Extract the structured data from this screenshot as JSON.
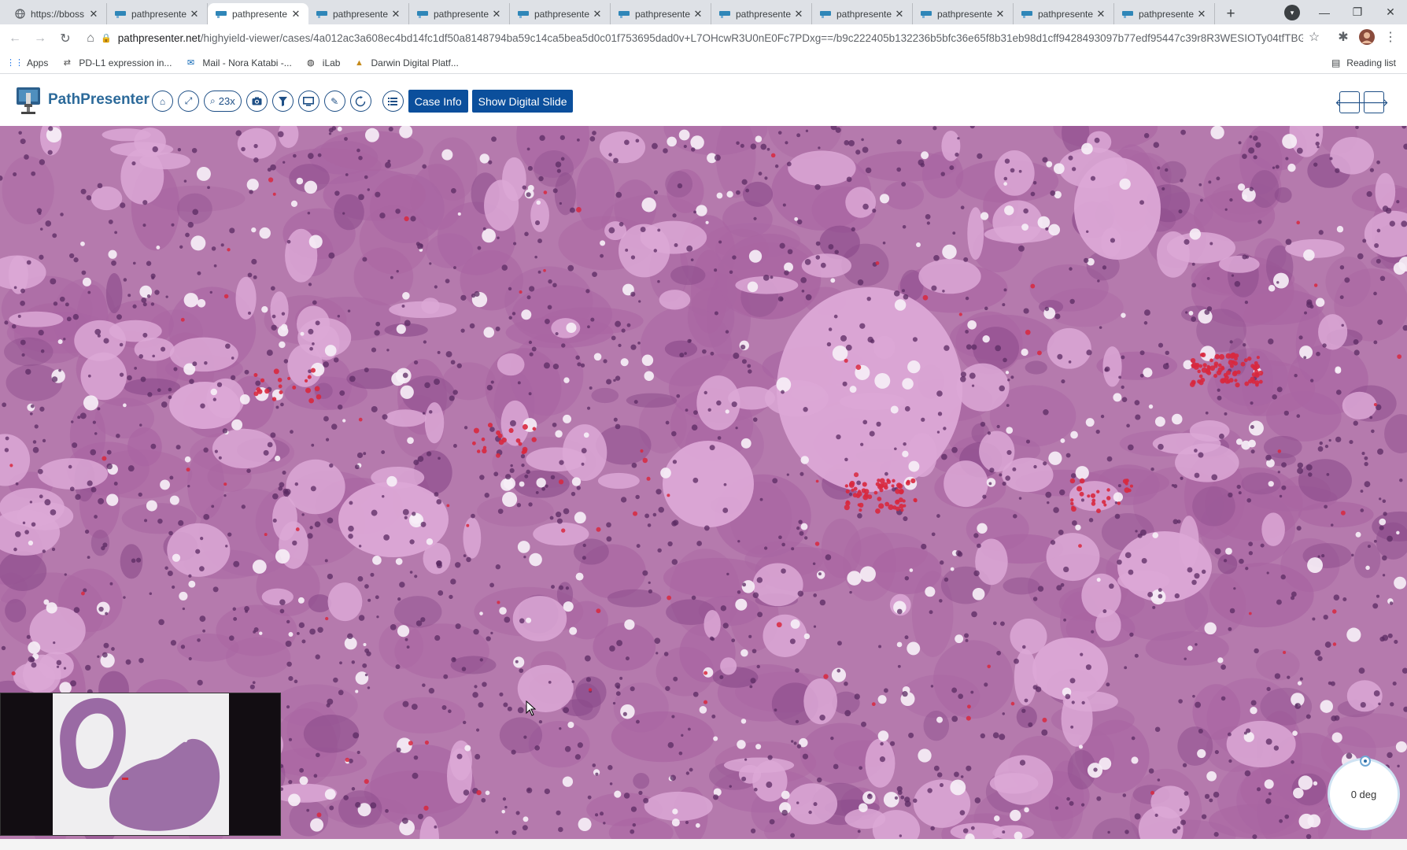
{
  "browser": {
    "tabs": [
      {
        "title": "https://bboss",
        "icon": "globe-icon",
        "active": false
      },
      {
        "title": "pathpresente",
        "icon": "pathpresenter-favicon",
        "active": false
      },
      {
        "title": "pathpresente",
        "icon": "pathpresenter-favicon",
        "active": true
      },
      {
        "title": "pathpresente",
        "icon": "pathpresenter-favicon",
        "active": false
      },
      {
        "title": "pathpresente",
        "icon": "pathpresenter-favicon",
        "active": false
      },
      {
        "title": "pathpresente",
        "icon": "pathpresenter-favicon",
        "active": false
      },
      {
        "title": "pathpresente",
        "icon": "pathpresenter-favicon",
        "active": false
      },
      {
        "title": "pathpresente",
        "icon": "pathpresenter-favicon",
        "active": false
      },
      {
        "title": "pathpresente",
        "icon": "pathpresenter-favicon",
        "active": false
      },
      {
        "title": "pathpresente",
        "icon": "pathpresenter-favicon",
        "active": false
      },
      {
        "title": "pathpresente",
        "icon": "pathpresenter-favicon",
        "active": false
      },
      {
        "title": "pathpresente",
        "icon": "pathpresenter-favicon",
        "active": false
      }
    ],
    "tab_close_glyph": "✕",
    "new_tab_glyph": "+",
    "url_host": "pathpresenter.net",
    "url_path": "/highyield-viewer/cases/4a012ac3a608ec4bd14fc1df50a8148794ba59c14ca5bea5d0c01f753695dad0v+L7OHcwR3U0nE0Fc7PDxg==/b9c222405b132236b5bfc36e65f8b31eb98d1cff9428493097b77edf95447c39r8R3WESIOTy04tfTBGW7qQ==...",
    "bookmarks": [
      {
        "label": "Apps",
        "icon": "apps-grid-icon"
      },
      {
        "label": "PD-L1 expression in...",
        "icon": "link-icon"
      },
      {
        "label": "Mail - Nora Katabi -...",
        "icon": "outlook-icon"
      },
      {
        "label": "iLab",
        "icon": "globe-icon"
      },
      {
        "label": "Darwin Digital Platf...",
        "icon": "darwin-icon"
      }
    ],
    "reading_list": "Reading list"
  },
  "app": {
    "name": "PathPresenter",
    "zoom": "23x",
    "tools": [
      "home-icon",
      "fullscreen-icon",
      "zoom-icon",
      "camera-icon",
      "filter-icon",
      "presentation-icon",
      "pen-icon",
      "rotate-icon",
      "list-icon"
    ],
    "case_info_label": "Case Info",
    "show_slide_label": "Show Digital Slide",
    "brand_color": "#0b4f9c"
  },
  "viewer": {
    "rotation_label": "0 deg",
    "stain_colors": {
      "background": "#b57aad",
      "cytoplasm": "#a965a2",
      "colloid": "#dca8d6",
      "nucleus": "#5b2b63",
      "rbc": "#d8283e"
    }
  }
}
